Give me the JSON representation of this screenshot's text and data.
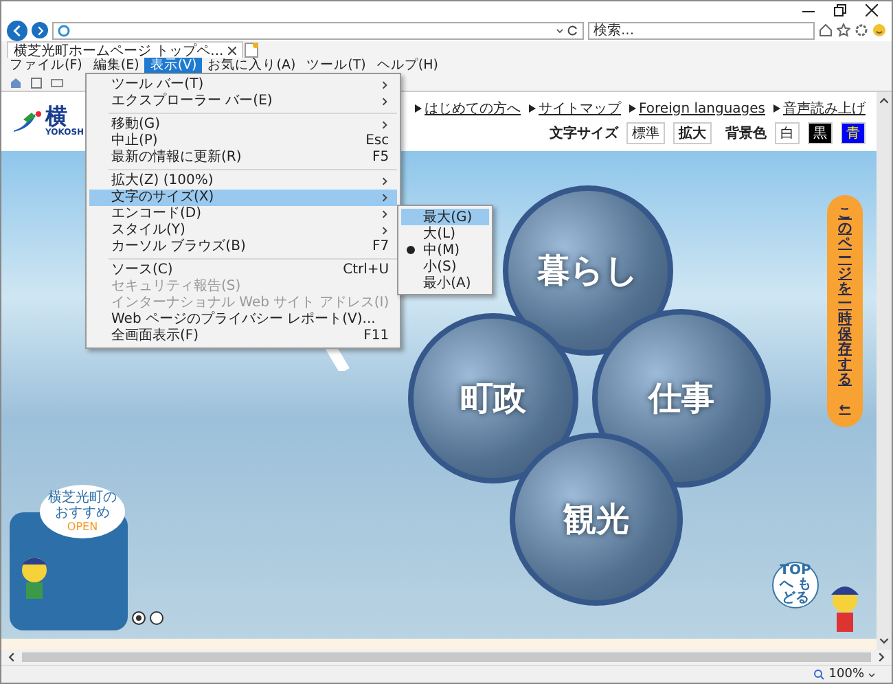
{
  "browser": {
    "search": {
      "placeholder": "検索..."
    },
    "tabs": [
      {
        "title": "横芝光町ホームページ トップペ...",
        "selected": true
      }
    ],
    "menu_bar": [
      {
        "label": "ファイル(F)",
        "selected": false
      },
      {
        "label": "編集(E)",
        "selected": false
      },
      {
        "label": "表示(V)",
        "selected": true
      },
      {
        "label": "お気に入り(A)",
        "selected": false
      },
      {
        "label": "ツール(T)",
        "selected": false
      },
      {
        "label": "ヘルプ(H)",
        "selected": false
      }
    ],
    "view_menu": [
      {
        "kind": "item",
        "label": "ツール バー(T)",
        "has_submenu": true,
        "disabled": false,
        "selected": false
      },
      {
        "kind": "item",
        "label": "エクスプローラー バー(E)",
        "has_submenu": true,
        "disabled": false,
        "selected": false
      },
      {
        "kind": "separator"
      },
      {
        "kind": "item",
        "label": "移動(G)",
        "has_submenu": true,
        "disabled": false,
        "selected": false
      },
      {
        "kind": "item",
        "label": "中止(P)",
        "shortcut": "Esc",
        "has_submenu": false,
        "disabled": false,
        "selected": false
      },
      {
        "kind": "item",
        "label": "最新の情報に更新(R)",
        "shortcut": "F5",
        "has_submenu": false,
        "disabled": false,
        "selected": false
      },
      {
        "kind": "separator"
      },
      {
        "kind": "item",
        "label": "拡大(Z) (100%)",
        "has_submenu": true,
        "disabled": false,
        "selected": false
      },
      {
        "kind": "item",
        "label": "文字のサイズ(X)",
        "has_submenu": true,
        "disabled": false,
        "selected": true
      },
      {
        "kind": "item",
        "label": "エンコード(D)",
        "has_submenu": true,
        "disabled": false,
        "selected": false
      },
      {
        "kind": "item",
        "label": "スタイル(Y)",
        "has_submenu": true,
        "disabled": false,
        "selected": false
      },
      {
        "kind": "item",
        "label": "カーソル ブラウズ(B)",
        "shortcut": "F7",
        "has_submenu": false,
        "disabled": false,
        "selected": false
      },
      {
        "kind": "separator"
      },
      {
        "kind": "item",
        "label": "ソース(C)",
        "shortcut": "Ctrl+U",
        "has_submenu": false,
        "disabled": false,
        "selected": false
      },
      {
        "kind": "item",
        "label": "セキュリティ報告(S)",
        "has_submenu": false,
        "disabled": true,
        "selected": false
      },
      {
        "kind": "item",
        "label": "インターナショナル Web サイト アドレス(I)",
        "has_submenu": false,
        "disabled": true,
        "selected": false
      },
      {
        "kind": "item",
        "label": "Web ページのプライバシー レポート(V)...",
        "has_submenu": false,
        "disabled": false,
        "selected": false
      },
      {
        "kind": "item",
        "label": "全画面表示(F)",
        "shortcut": "F11",
        "has_submenu": false,
        "disabled": false,
        "selected": false
      }
    ],
    "text_size_menu": [
      {
        "label": "最大(G)",
        "selected": true,
        "checked": false
      },
      {
        "label": "大(L)",
        "selected": false,
        "checked": false
      },
      {
        "label": "中(M)",
        "selected": false,
        "checked": true
      },
      {
        "label": "小(S)",
        "selected": false,
        "checked": false
      },
      {
        "label": "最小(A)",
        "selected": false,
        "checked": false
      }
    ],
    "zoom": "100%"
  },
  "site": {
    "logo": {
      "text": "横",
      "subtitle": "YOKOSH"
    },
    "nav_links": [
      "はじめての方へ",
      "サイトマップ",
      "Foreign languages",
      "音声読み上げ"
    ],
    "text_size": {
      "label": "文字サイズ",
      "buttons": [
        {
          "label": "標準",
          "selected": false
        },
        {
          "label": "拡大",
          "selected": true
        }
      ]
    },
    "background_color": {
      "label": "背景色",
      "options": [
        {
          "label": "白",
          "color": "#ffffff"
        },
        {
          "label": "黒",
          "color": "#000000"
        },
        {
          "label": "青",
          "color": "#0000ff"
        }
      ]
    },
    "categories": [
      {
        "label": "暮らし"
      },
      {
        "label": "町政"
      },
      {
        "label": "仕事"
      },
      {
        "label": "観光"
      }
    ],
    "save_tab": {
      "label": "このページを一時保存する",
      "arrow": "←"
    },
    "recommend": {
      "title": "横芝光町のおすすめ",
      "open": "OPEN"
    },
    "slides": [
      {
        "selected": true
      },
      {
        "selected": false
      }
    ],
    "top_button": {
      "label": "TOPへ もどる"
    }
  }
}
